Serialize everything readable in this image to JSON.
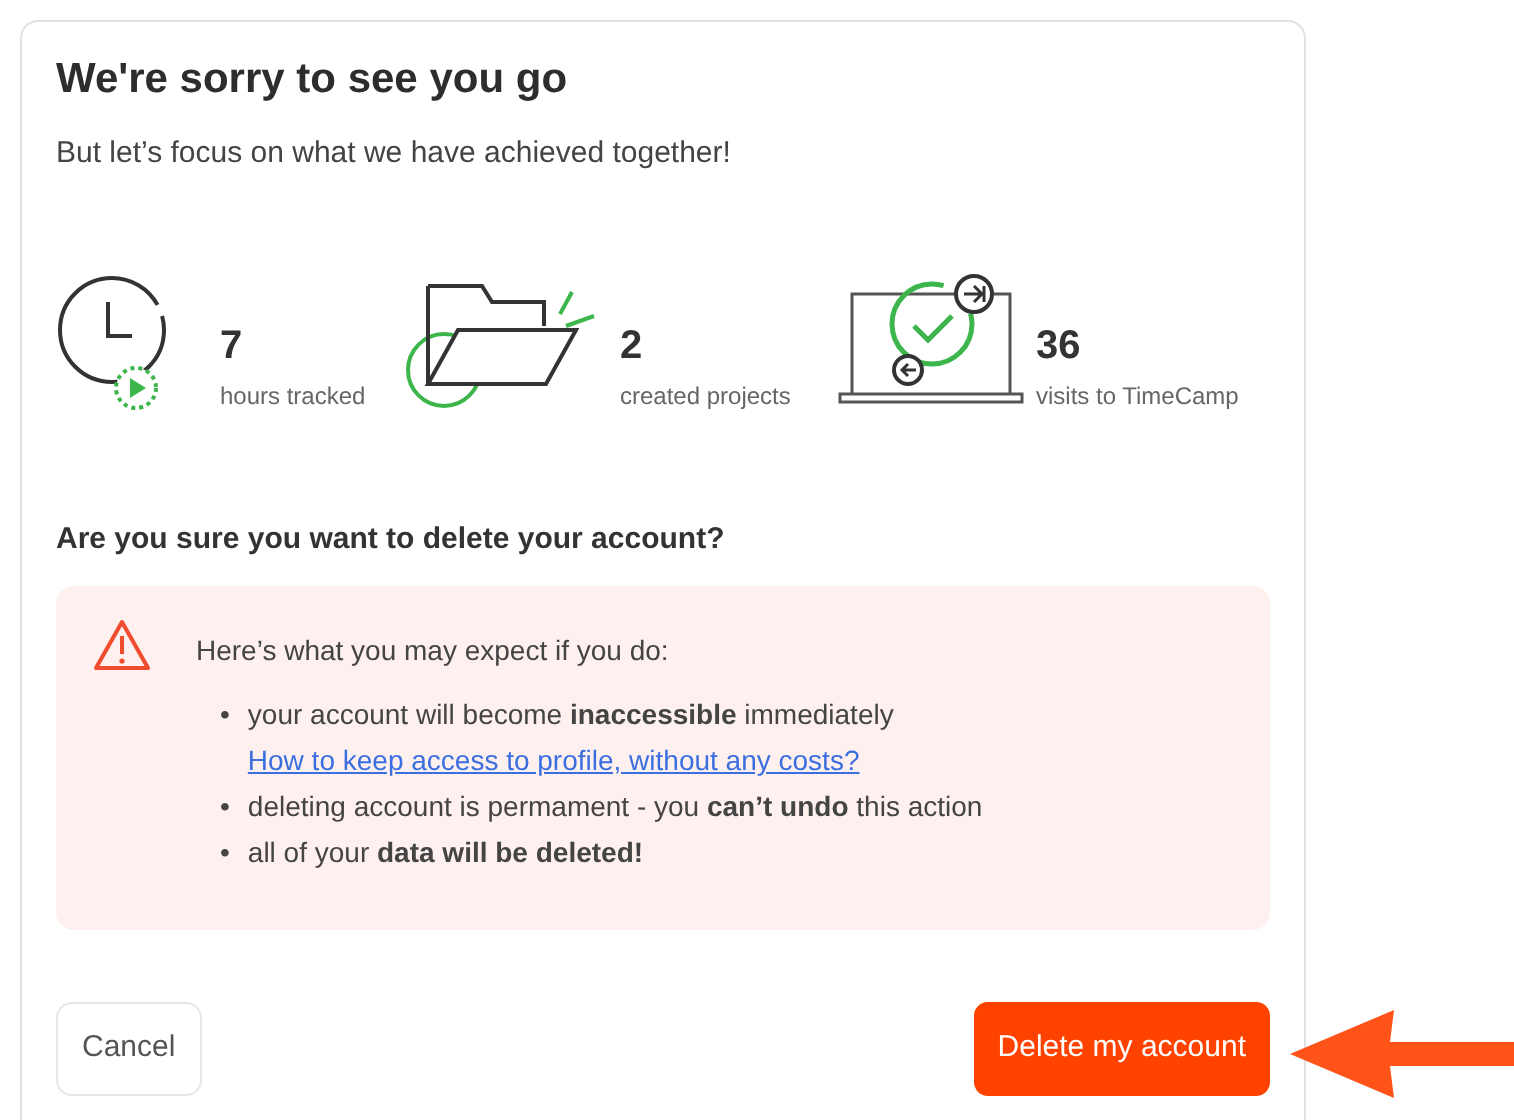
{
  "title": "We're sorry to see you go",
  "subtitle": "But let’s focus on what we have achieved together!",
  "stats": [
    {
      "kind": "clock",
      "value": "7",
      "label": "hours tracked"
    },
    {
      "kind": "folder",
      "value": "2",
      "label": "created projects"
    },
    {
      "kind": "laptop",
      "value": "36",
      "label": "visits to TimeCamp"
    }
  ],
  "question": "Are you sure you want to delete your account?",
  "warning": {
    "intro": "Here’s what you may expect if you do:",
    "bullets": [
      {
        "marker": "•",
        "text": "your account will become **inaccessible** immediately",
        "link": "How to keep access to profile, without any costs?"
      },
      {
        "marker": "•",
        "text": "deleting account is permament - you **can’t undo** this action"
      },
      {
        "marker": "•",
        "text": "all of your **data will be deleted!**"
      }
    ]
  },
  "buttons": [
    {
      "kind": "secondary",
      "label": "Cancel"
    },
    {
      "kind": "danger",
      "label": "Delete my account"
    }
  ]
}
